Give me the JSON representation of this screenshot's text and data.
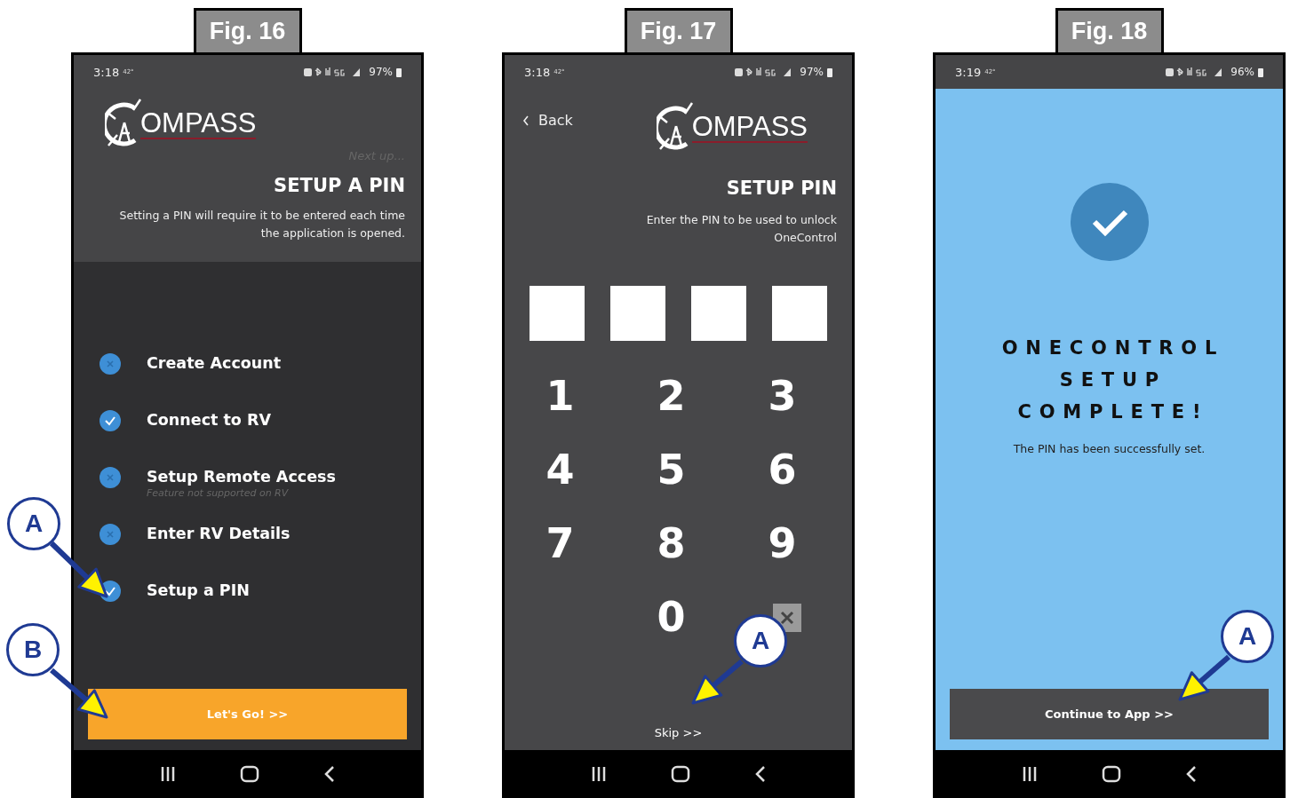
{
  "figures": [
    {
      "label": "Fig. 16",
      "kind": "intro",
      "status": {
        "time": "3:18",
        "temp": "42°",
        "battery": "97%"
      },
      "logo": "OMPASS",
      "next_up": "Next up...",
      "title": "SETUP A PIN",
      "description": "Setting a PIN will require it to be entered each time the application is opened.",
      "steps": [
        {
          "label": "Create Account",
          "done": false
        },
        {
          "label": "Connect to RV",
          "done": true
        },
        {
          "label": "Setup Remote Access",
          "note": "Feature not supported on RV",
          "done": false
        },
        {
          "label": "Enter RV Details",
          "done": false
        },
        {
          "label": "Setup a PIN",
          "done": true
        }
      ],
      "button": "Let's Go! >>",
      "callouts": [
        "A",
        "B"
      ]
    },
    {
      "label": "Fig. 17",
      "kind": "pin",
      "status": {
        "time": "3:18",
        "temp": "42°",
        "battery": "97%"
      },
      "back": "Back",
      "logo": "OMPASS",
      "title": "SETUP PIN",
      "description": "Enter the PIN to be used to unlock OneControl",
      "pin_boxes": [
        {
          "filled": false
        },
        {
          "filled": false
        },
        {
          "filled": false
        },
        {
          "filled": false
        }
      ],
      "keys": [
        "1",
        "2",
        "3",
        "4",
        "5",
        "6",
        "7",
        "8",
        "9",
        "0"
      ],
      "skip": "Skip >>",
      "callouts": [
        "A"
      ]
    },
    {
      "label": "Fig. 18",
      "kind": "done",
      "status": {
        "time": "3:19",
        "temp": "42°",
        "battery": "96%"
      },
      "title_lines": [
        "ONECONTROL",
        "SETUP",
        "COMPLETE!"
      ],
      "message": "The PIN has been successfully set.",
      "button": "Continue to App >>",
      "callouts": [
        "A"
      ]
    }
  ]
}
